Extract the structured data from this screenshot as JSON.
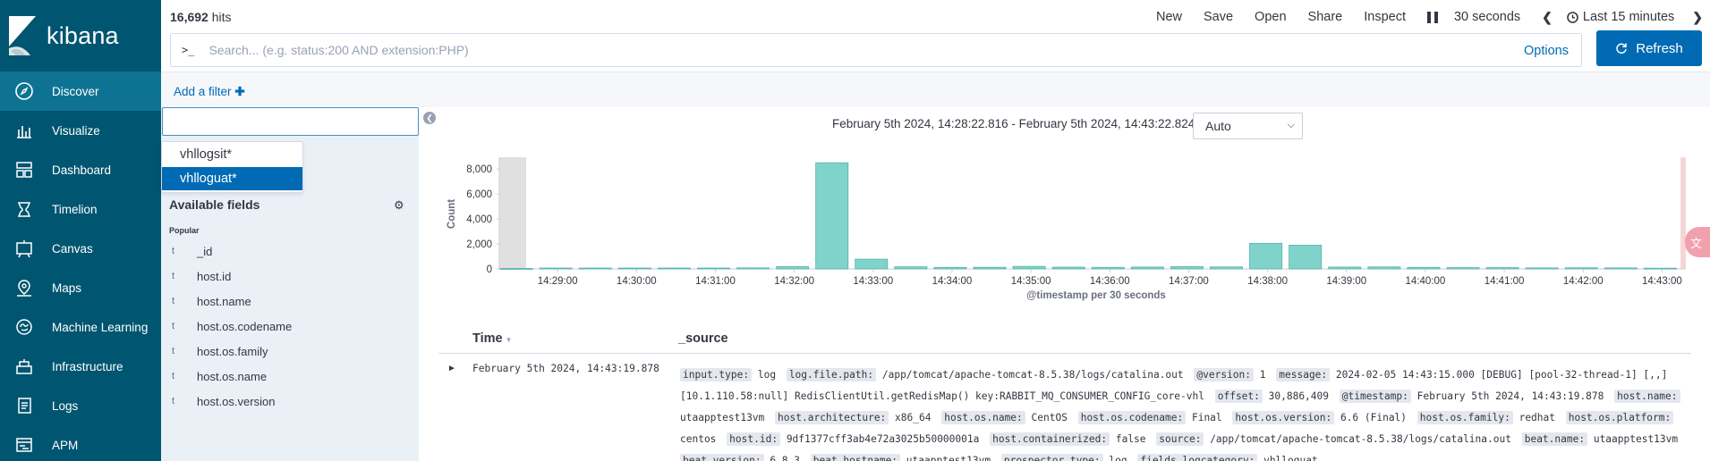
{
  "nav": {
    "brand": "kibana",
    "items": [
      {
        "label": "Discover",
        "icon": "compass-icon",
        "active": true
      },
      {
        "label": "Visualize",
        "icon": "visualize-icon"
      },
      {
        "label": "Dashboard",
        "icon": "dashboard-icon"
      },
      {
        "label": "Timelion",
        "icon": "timelion-icon"
      },
      {
        "label": "Canvas",
        "icon": "canvas-icon"
      },
      {
        "label": "Maps",
        "icon": "maps-icon"
      },
      {
        "label": "Machine Learning",
        "icon": "machine-learning-icon"
      },
      {
        "label": "Infrastructure",
        "icon": "infrastructure-icon"
      },
      {
        "label": "Logs",
        "icon": "logs-icon"
      },
      {
        "label": "APM",
        "icon": "apm-icon"
      }
    ]
  },
  "top": {
    "hits_count": "16,692",
    "hits_label": "hits",
    "menu": {
      "new": "New",
      "save": "Save",
      "open": "Open",
      "share": "Share",
      "inspect": "Inspect"
    },
    "refresh_interval": "30 seconds",
    "time_range": "Last 15 minutes"
  },
  "search": {
    "prompt": ">_",
    "placeholder": "Search... (e.g. status:200 AND extension:PHP)",
    "options_label": "Options",
    "refresh_label": "Refresh"
  },
  "filter": {
    "add_label": "Add a filter"
  },
  "index_pattern": {
    "input_value": "",
    "options": [
      "vhllogsit*",
      "vhlloguat*"
    ],
    "selected": "vhlloguat*"
  },
  "fields": {
    "header": "Available fields",
    "section": "Popular",
    "type_symbol": "t",
    "list": [
      "_id",
      "host.id",
      "host.name",
      "host.os.codename",
      "host.os.family",
      "host.os.name",
      "host.os.version"
    ]
  },
  "histogram": {
    "range_label": "February 5th 2024, 14:28:22.816 - February 5th 2024, 14:43:22.824 —",
    "interval": "Auto"
  },
  "chart_data": {
    "type": "bar",
    "ylabel": "Count",
    "xlabel": "@timestamp per 30 seconds",
    "ylim": [
      0,
      8800
    ],
    "yticks": [
      "0",
      "2,000",
      "4,000",
      "6,000",
      "8,000"
    ],
    "ytick_values": [
      0,
      2000,
      4000,
      6000,
      8000
    ],
    "xticks": [
      "14:29:00",
      "14:30:00",
      "14:31:00",
      "14:32:00",
      "14:33:00",
      "14:34:00",
      "14:35:00",
      "14:36:00",
      "14:37:00",
      "14:38:00",
      "14:39:00",
      "14:40:00",
      "14:41:00",
      "14:42:00",
      "14:43:00"
    ],
    "bar_color": "#7fd3cb",
    "values": [
      40,
      70,
      70,
      70,
      70,
      70,
      80,
      180,
      8500,
      780,
      170,
      120,
      130,
      200,
      140,
      120,
      150,
      180,
      160,
      2050,
      1900,
      150,
      160,
      120,
      100,
      100,
      80,
      90,
      80,
      60
    ]
  },
  "table": {
    "col_time": "Time",
    "col_source": "_source",
    "row": {
      "time": "February 5th 2024, 14:43:19.878",
      "source": [
        {
          "k": "input.type:",
          "v": "log"
        },
        {
          "k": "log.file.path:",
          "v": "/app/tomcat/apache-tomcat-8.5.38/logs/catalina.out"
        },
        {
          "k": "@version:",
          "v": "1"
        },
        {
          "k": "message:",
          "v": "2024-02-05 14:43:15.000 [DEBUG] [pool-32-thread-1] [,,] [10.1.110.58:null] RedisClientUtil.getRedisMap() key:RABBIT_MQ_CONSUMER_CONFIG_core-vhl"
        },
        {
          "k": "offset:",
          "v": "30,886,409"
        },
        {
          "k": "@timestamp:",
          "v": "February 5th 2024, 14:43:19.878"
        },
        {
          "k": "host.name:",
          "v": "utaapptest13vm"
        },
        {
          "k": "host.architecture:",
          "v": "x86_64"
        },
        {
          "k": "host.os.name:",
          "v": "CentOS"
        },
        {
          "k": "host.os.codename:",
          "v": "Final"
        },
        {
          "k": "host.os.version:",
          "v": "6.6 (Final)"
        },
        {
          "k": "host.os.family:",
          "v": "redhat"
        },
        {
          "k": "host.os.platform:",
          "v": "centos"
        },
        {
          "k": "host.id:",
          "v": "9df1377cff3ab4e72a3025b50000001a"
        },
        {
          "k": "host.containerized:",
          "v": "false"
        },
        {
          "k": "source:",
          "v": "/app/tomcat/apache-tomcat-8.5.38/logs/catalina.out"
        },
        {
          "k": "beat.name:",
          "v": "utaapptest13vm"
        },
        {
          "k": "beat.version:",
          "v": "6.8.3"
        },
        {
          "k": "beat.hostname:",
          "v": "utaapptest13vm"
        },
        {
          "k": "prospector.type:",
          "v": "log"
        },
        {
          "k": "fields.logcategory:",
          "v": "vhlloguat"
        }
      ]
    }
  },
  "colors": {
    "nav_bg": "#005571",
    "nav_active": "#0e7393",
    "accent": "#006bb4",
    "panel_bg": "#e9f1f7"
  }
}
